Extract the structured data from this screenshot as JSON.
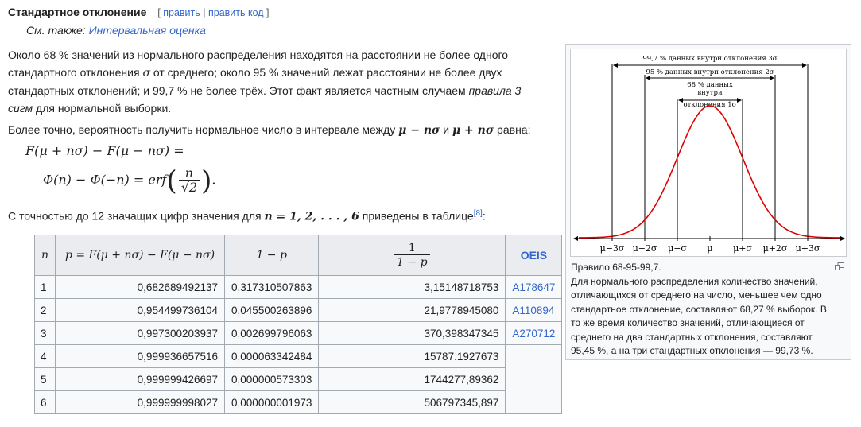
{
  "heading": {
    "title": "Стандартное отклонение",
    "edit_open": "[ ",
    "edit_link": "править",
    "edit_sep": " | ",
    "edit_code_link": "править код",
    "edit_close": " ]"
  },
  "see_also": {
    "prefix": "См. также: ",
    "link": "Интервальная оценка"
  },
  "para1": {
    "text_a": "Около 68 % значений из нормального распределения находятся на расстоянии не более одного стандартного отклонения ",
    "sigma": "σ",
    "text_b": " от среднего; около 95 % значений лежат расстоянии не более двух стандартных отклонений; и 99,7 % не более трёх. Этот факт является частным случаем ",
    "italic": "правила 3 сигм",
    "text_c": " для нормальной выборки."
  },
  "para2": {
    "text_a": "Более точно, вероятность получить нормальное число в интервале между ",
    "expr1": "μ − nσ",
    "and": " и ",
    "expr2": "μ + nσ",
    "text_b": " равна:"
  },
  "formula": {
    "line1": "F(μ + nσ) − F(μ − nσ) =",
    "line2_left": "Φ(n) − Φ(−n) = erf",
    "frac_num": "n",
    "frac_den": "√2",
    "line2_end": "."
  },
  "para3": {
    "text_a": "С точностью до 12 значащих цифр значения для ",
    "expr": "n = 1, 2, . . . , 6",
    "text_b": " приведены в таблице",
    "ref": "[8]",
    "text_c": ":"
  },
  "table": {
    "headers": {
      "n": "n",
      "p": "p = F(μ + nσ) − F(μ − nσ)",
      "q": "1 − p",
      "r_num": "1",
      "r_den": "1 − p",
      "oeis": "OEIS"
    },
    "rows": [
      {
        "n": "1",
        "p": "0,682689492137",
        "q": "0,317310507863",
        "r": "3,15148718753",
        "oeis": "A178647"
      },
      {
        "n": "2",
        "p": "0,954499736104",
        "q": "0,045500263896",
        "r": "21,9778945080",
        "oeis": "A110894"
      },
      {
        "n": "3",
        "p": "0,997300203937",
        "q": "0,002699796063",
        "r": "370,398347345",
        "oeis": "A270712"
      },
      {
        "n": "4",
        "p": "0,999936657516",
        "q": "0,000063342484",
        "r": "15787.1927673",
        "oeis": ""
      },
      {
        "n": "5",
        "p": "0,999999426697",
        "q": "0,000000573303",
        "r": "1744277,89362",
        "oeis": ""
      },
      {
        "n": "6",
        "p": "0,999999998027",
        "q": "0,000000001973",
        "r": "506797345,897",
        "oeis": ""
      }
    ]
  },
  "figure": {
    "label_3s": "99,7 % данных внутри отклонения 3σ",
    "label_2s": "95 % данных внутри отклонения 2σ",
    "label_1s_a": "68 % данных",
    "label_1s_b": "внутри",
    "label_1s_c": "отклонения 1σ",
    "ticks": [
      "μ−3σ",
      "μ−2σ",
      "μ−σ",
      "μ",
      "μ+σ",
      "μ+2σ",
      "μ+3σ"
    ],
    "colors": {
      "curve": "#e00000",
      "axis": "#000000"
    }
  },
  "caption": {
    "title": "Правило 68-95-99,7.",
    "text": "Для нормального распределения количество значений, отличающихся от среднего на число, меньшее чем одно стандартное отклонение, составляют 68,27 % выборок. В то же время количество значений, отличающиеся от среднего на два стандартных отклонения, составляют 95,45 %, а на три стандартных отклонения — 99,73 %."
  }
}
